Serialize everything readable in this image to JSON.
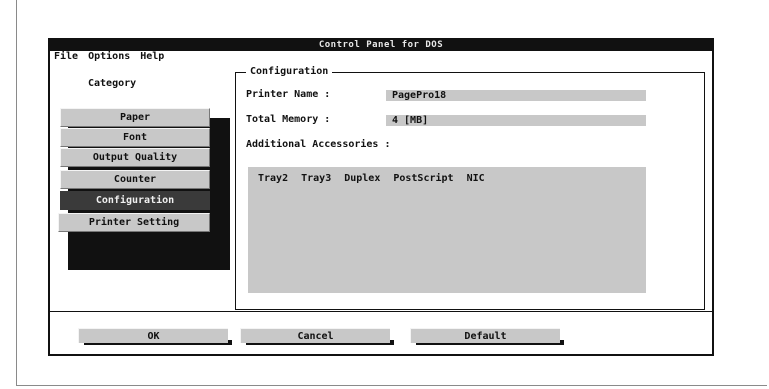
{
  "window": {
    "title": "Control Panel for DOS"
  },
  "menu": [
    "File",
    "Options",
    "Help"
  ],
  "sidebar": {
    "label": "Category",
    "items": [
      {
        "label": "Paper",
        "active": false
      },
      {
        "label": "Font",
        "active": false
      },
      {
        "label": "Output Quality",
        "active": false
      },
      {
        "label": "Counter",
        "active": false
      },
      {
        "label": "Configuration",
        "active": true
      },
      {
        "label": "Printer Setting",
        "active": false
      }
    ]
  },
  "config": {
    "group_title": "Configuration",
    "printer_name_label": "Printer Name :",
    "printer_name_value": "PagePro18",
    "total_memory_label": "Total Memory :",
    "total_memory_value": "4 [MB]",
    "accessories_label": "Additional Accessories :",
    "accessories": [
      "Tray2",
      "Tray3",
      "Duplex",
      "PostScript",
      "NIC"
    ]
  },
  "buttons": {
    "ok": "OK",
    "cancel": "Cancel",
    "default": "Default"
  },
  "colors": {
    "titlebar": "#111111",
    "button_face": "#c8c8c8",
    "active_item": "#3a3a3a"
  }
}
